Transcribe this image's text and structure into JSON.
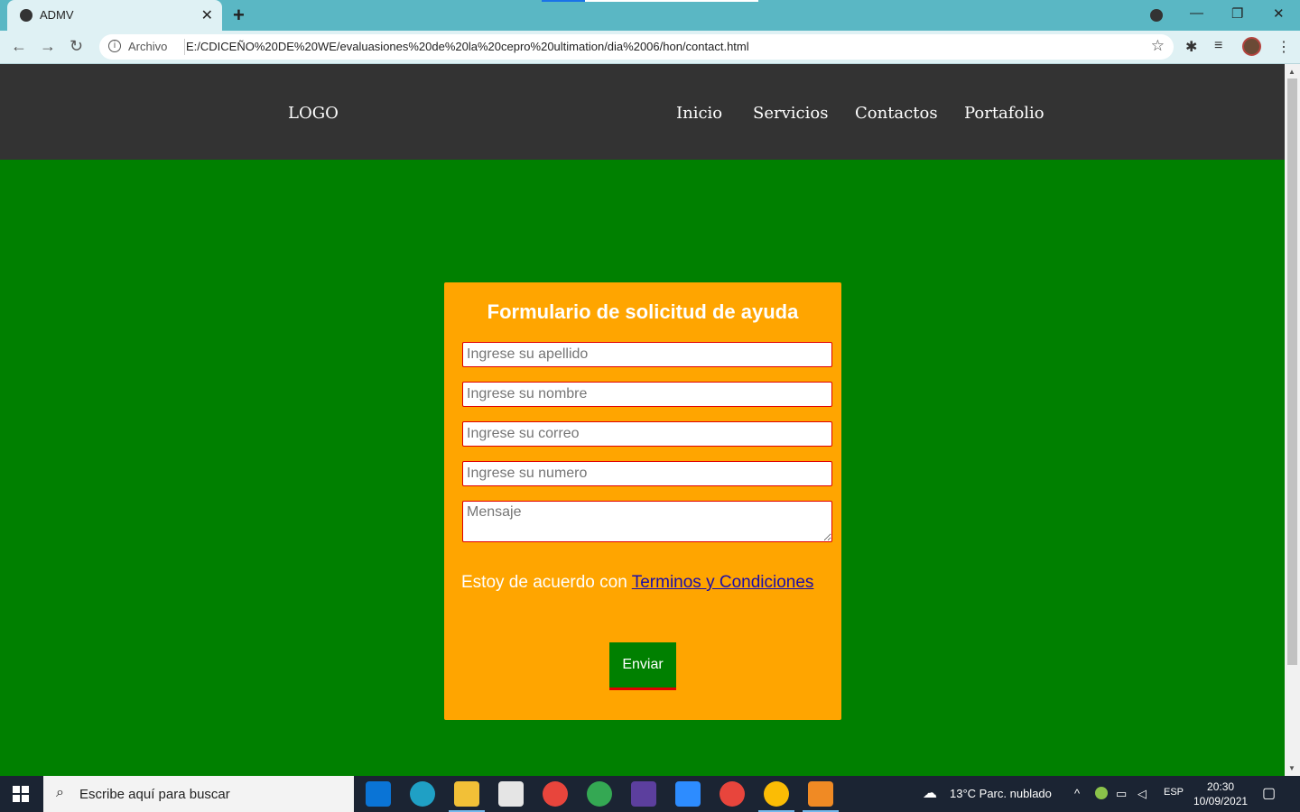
{
  "browser": {
    "tab_title": "ADMV",
    "tab_close": "✕",
    "new_tab": "+",
    "scheme_label": "Archivo",
    "url": "E:/CDICEÑO%20DE%20WE/evaluasiones%20de%20la%20cepro%20ultimation/dia%2006/hon/contact.html"
  },
  "site": {
    "logo": "LOGO",
    "nav": [
      "Inicio",
      "Servicios",
      "Contactos",
      "Portafolio"
    ]
  },
  "form": {
    "title": "Formulario de solicitud de ayuda",
    "placeholders": {
      "apellido": "Ingrese su apellido",
      "nombre": "Ingrese su nombre",
      "correo": "Ingrese su correo",
      "numero": "Ingrese su numero",
      "mensaje": "Mensaje"
    },
    "terms_prefix": "Estoy de acuerdo con",
    "terms_link": "Terminos y Condiciones",
    "submit": "Enviar"
  },
  "taskbar": {
    "search_placeholder": "Escribe aquí para buscar",
    "weather": "13°C  Parc. nublado",
    "language": "ESP",
    "time": "20:30",
    "date": "10/09/2021"
  },
  "colors": {
    "header": "#333333",
    "page_bg": "#008000",
    "form_bg": "#ffa500",
    "input_border": "#e00000",
    "link": "#1a0dab"
  }
}
